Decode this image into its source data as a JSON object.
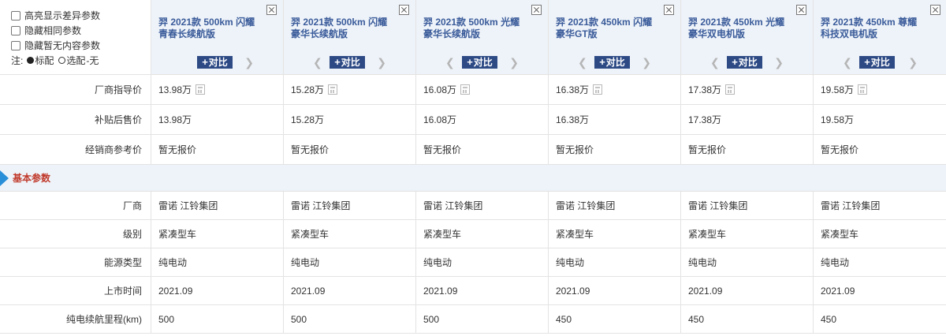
{
  "options": {
    "highlight_diff": "高亮显示差异参数",
    "hide_same": "隐藏相同参数",
    "hide_empty": "隐藏暂无内容参数"
  },
  "legend": {
    "prefix": "注:",
    "standard": "标配",
    "optional": "选配",
    "none": "-无"
  },
  "compare_label": "对比",
  "cars": [
    {
      "name": "羿 2021款 500km 闪耀青春长续航版",
      "has_prev": false
    },
    {
      "name": "羿 2021款 500km 闪耀豪华长续航版",
      "has_prev": true
    },
    {
      "name": "羿 2021款 500km 光耀豪华长续航版",
      "has_prev": true
    },
    {
      "name": "羿 2021款 450km 闪耀豪华GT版",
      "has_prev": true
    },
    {
      "name": "羿 2021款 450km 光耀豪华双电机版",
      "has_prev": true
    },
    {
      "name": "羿 2021款 450km 尊耀科技双电机版",
      "has_prev": true
    }
  ],
  "price_rows": [
    {
      "label": "厂商指导价",
      "values": [
        "13.98万",
        "15.28万",
        "16.08万",
        "16.38万",
        "17.38万",
        "19.58万"
      ],
      "calc": true
    },
    {
      "label": "补贴后售价",
      "values": [
        "13.98万",
        "15.28万",
        "16.08万",
        "16.38万",
        "17.38万",
        "19.58万"
      ],
      "calc": false
    },
    {
      "label": "经销商参考价",
      "values": [
        "暂无报价",
        "暂无报价",
        "暂无报价",
        "暂无报价",
        "暂无报价",
        "暂无报价"
      ],
      "calc": false
    }
  ],
  "section_title": "基本参数",
  "basic_rows": [
    {
      "label": "厂商",
      "values": [
        "雷诺 江铃集团",
        "雷诺 江铃集团",
        "雷诺 江铃集团",
        "雷诺 江铃集团",
        "雷诺 江铃集团",
        "雷诺 江铃集团"
      ]
    },
    {
      "label": "级别",
      "values": [
        "紧凑型车",
        "紧凑型车",
        "紧凑型车",
        "紧凑型车",
        "紧凑型车",
        "紧凑型车"
      ]
    },
    {
      "label": "能源类型",
      "values": [
        "纯电动",
        "纯电动",
        "纯电动",
        "纯电动",
        "纯电动",
        "纯电动"
      ]
    },
    {
      "label": "上市时间",
      "values": [
        "2021.09",
        "2021.09",
        "2021.09",
        "2021.09",
        "2021.09",
        "2021.09"
      ]
    },
    {
      "label": "纯电续航里程(km)",
      "values": [
        "500",
        "500",
        "500",
        "450",
        "450",
        "450"
      ]
    }
  ]
}
